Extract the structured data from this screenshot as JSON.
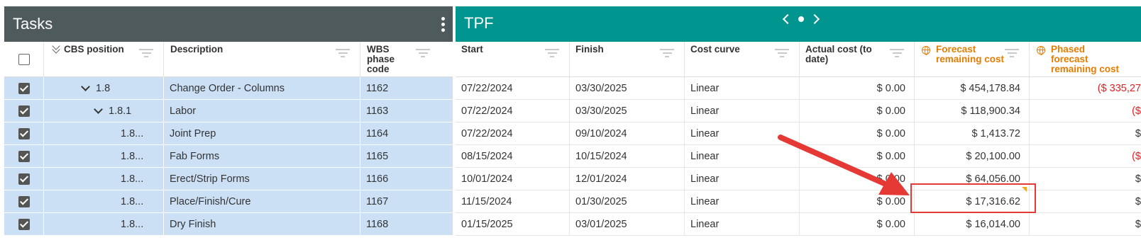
{
  "tasks_panel": {
    "title": "Tasks",
    "columns": {
      "cbs_position": "CBS position",
      "description": "Description",
      "wbs_phase_code": "WBS phase code"
    },
    "rows": [
      {
        "cbs": "1.8",
        "description": "Change Order - Columns",
        "wbs": "1162",
        "checked": true
      },
      {
        "cbs": "1.8.1",
        "description": "Labor",
        "wbs": "1163",
        "checked": true
      },
      {
        "cbs": "1.8...",
        "description": "Joint Prep",
        "wbs": "1164",
        "checked": true
      },
      {
        "cbs": "1.8...",
        "description": "Fab Forms",
        "wbs": "1165",
        "checked": true
      },
      {
        "cbs": "1.8...",
        "description": "Erect/Strip Forms",
        "wbs": "1166",
        "checked": true
      },
      {
        "cbs": "1.8...",
        "description": "Place/Finish/Cure",
        "wbs": "1167",
        "checked": true
      },
      {
        "cbs": "1.8...",
        "description": "Dry Finish",
        "wbs": "1168",
        "checked": true
      }
    ]
  },
  "tpf_panel": {
    "title": "TPF",
    "columns": {
      "start": "Start",
      "finish": "Finish",
      "cost_curve": "Cost curve",
      "actual_cost": "Actual cost (to date)",
      "forecast_remaining": "Forecast remaining cost",
      "phased_forecast": "Phased forecast remaining cost"
    },
    "rows": [
      {
        "start": "07/22/2024",
        "finish": "03/30/2025",
        "curve": "Linear",
        "actual": "$ 0.00",
        "forecast": "$ 454,178.84",
        "phased": "($ 335,27"
      },
      {
        "start": "07/22/2024",
        "finish": "03/30/2025",
        "curve": "Linear",
        "actual": "$ 0.00",
        "forecast": "$ 118,900.34",
        "phased": "($"
      },
      {
        "start": "07/22/2024",
        "finish": "09/10/2024",
        "curve": "Linear",
        "actual": "$ 0.00",
        "forecast": "$ 1,413.72",
        "phased": "$"
      },
      {
        "start": "08/15/2024",
        "finish": "10/15/2024",
        "curve": "Linear",
        "actual": "$ 0.00",
        "forecast": "$ 20,100.00",
        "phased": "($"
      },
      {
        "start": "10/01/2024",
        "finish": "12/01/2024",
        "curve": "Linear",
        "actual": "$ 0.00",
        "forecast": "$ 64,056.00",
        "phased": "$"
      },
      {
        "start": "11/15/2024",
        "finish": "01/30/2025",
        "curve": "Linear",
        "actual": "$ 0.00",
        "forecast": "$ 17,316.62",
        "phased": "$"
      },
      {
        "start": "01/15/2025",
        "finish": "03/01/2025",
        "curve": "Linear",
        "actual": "$ 0.00",
        "forecast": "$ 16,014.00",
        "phased": "$"
      }
    ]
  },
  "colors": {
    "tasks_header": "#4f5a5c",
    "tpf_header": "#00958f",
    "selected_row": "#cce0f5",
    "highlight_box": "#e53935",
    "negative_value": "#e02020",
    "orange_header": "#e57c00"
  }
}
